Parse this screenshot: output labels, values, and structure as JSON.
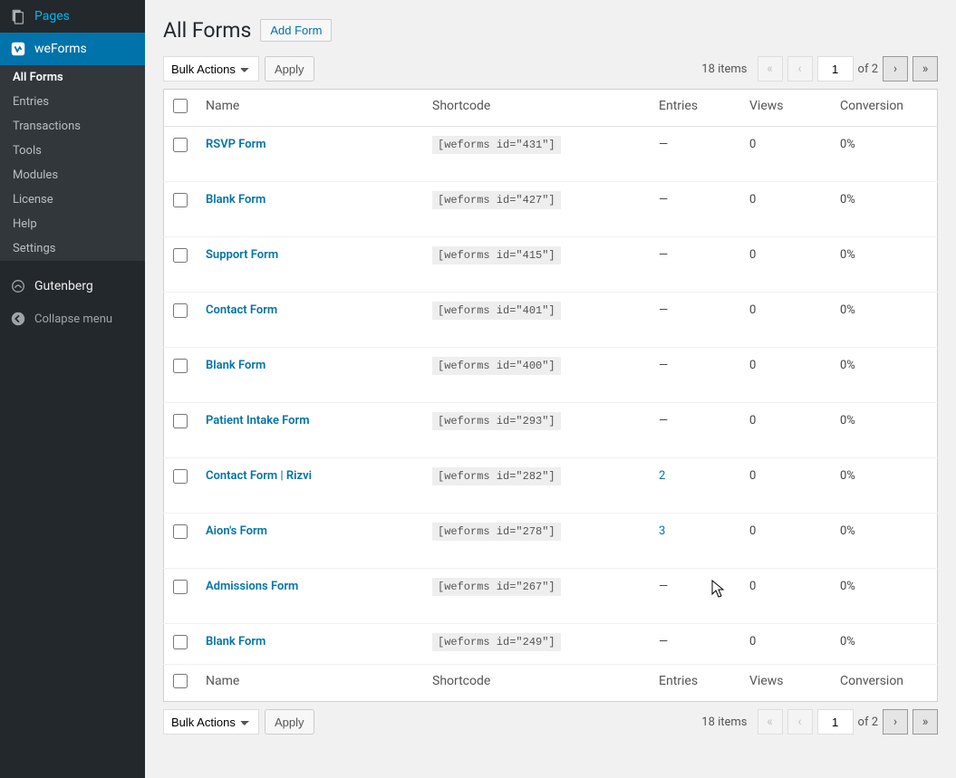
{
  "sidebar": {
    "pages_label": "Pages",
    "weforms_label": "weForms",
    "submenu": [
      "All Forms",
      "Entries",
      "Transactions",
      "Tools",
      "Modules",
      "License",
      "Help",
      "Settings"
    ],
    "gutenberg_label": "Gutenberg",
    "collapse_label": "Collapse menu"
  },
  "header": {
    "title": "All Forms",
    "add_button": "Add Form"
  },
  "bulk": {
    "select_label": "Bulk Actions",
    "apply_label": "Apply"
  },
  "pagination": {
    "items_label": "18 items",
    "current_page": "1",
    "of_label": "of 2"
  },
  "columns": {
    "name": "Name",
    "shortcode": "Shortcode",
    "entries": "Entries",
    "views": "Views",
    "conversion": "Conversion"
  },
  "forms": [
    {
      "name": "RSVP Form",
      "shortcode": "[weforms id=\"431\"]",
      "entries": "—",
      "views": "0",
      "conversion": "0%",
      "entries_link": false
    },
    {
      "name": "Blank Form",
      "shortcode": "[weforms id=\"427\"]",
      "entries": "—",
      "views": "0",
      "conversion": "0%",
      "entries_link": false
    },
    {
      "name": "Support Form",
      "shortcode": "[weforms id=\"415\"]",
      "entries": "—",
      "views": "0",
      "conversion": "0%",
      "entries_link": false
    },
    {
      "name": "Contact Form",
      "shortcode": "[weforms id=\"401\"]",
      "entries": "—",
      "views": "0",
      "conversion": "0%",
      "entries_link": false
    },
    {
      "name": "Blank Form",
      "shortcode": "[weforms id=\"400\"]",
      "entries": "—",
      "views": "0",
      "conversion": "0%",
      "entries_link": false
    },
    {
      "name": "Patient Intake Form",
      "shortcode": "[weforms id=\"293\"]",
      "entries": "—",
      "views": "0",
      "conversion": "0%",
      "entries_link": false
    },
    {
      "name": "Contact Form | Rizvi",
      "shortcode": "[weforms id=\"282\"]",
      "entries": "2",
      "views": "0",
      "conversion": "0%",
      "entries_link": true
    },
    {
      "name": "Aion's Form",
      "shortcode": "[weforms id=\"278\"]",
      "entries": "3",
      "views": "0",
      "conversion": "0%",
      "entries_link": true
    },
    {
      "name": "Admissions Form",
      "shortcode": "[weforms id=\"267\"]",
      "entries": "—",
      "views": "0",
      "conversion": "0%",
      "entries_link": false
    },
    {
      "name": "Blank Form",
      "shortcode": "[weforms id=\"249\"]",
      "entries": "—",
      "views": "0",
      "conversion": "0%",
      "entries_link": false
    }
  ]
}
